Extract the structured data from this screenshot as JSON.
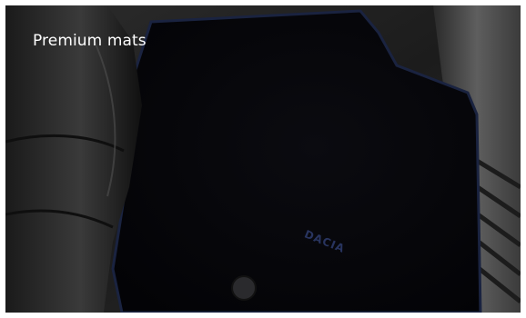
{
  "caption": "Premium mats",
  "image": {
    "subject": "black carpet floor mat in car footwell",
    "brand_mark": "DACIA",
    "colors": {
      "mat": "#050509",
      "mat_edging": "#1a2340",
      "brand_text": "#28345f",
      "seat_leather": "#2a2a2a",
      "floor_carpet": "#3a3a3a",
      "sill_trim": "#555555"
    }
  }
}
